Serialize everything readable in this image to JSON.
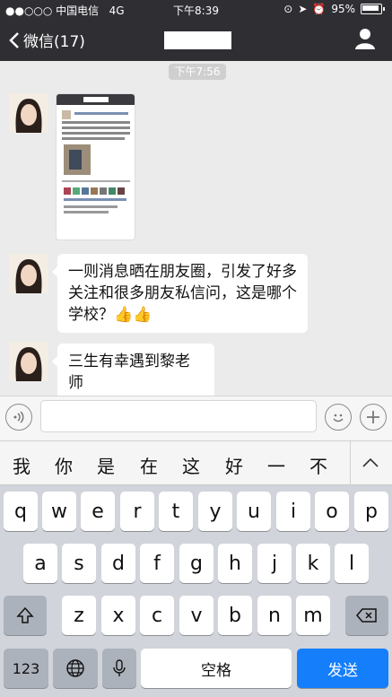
{
  "status": {
    "carrier": "●●○○○ 中国电信",
    "network": "4G",
    "time": "下午8:39",
    "battery": "95%"
  },
  "nav": {
    "back_label": "微信(17)"
  },
  "chat": {
    "timestamp": "下午7:56",
    "messages": [
      {
        "type": "image"
      },
      {
        "type": "text",
        "lines": [
          "一则消息晒在朋友圈，引发了好多",
          "关注和很多朋友私信问，这是哪个",
          "学校？👍👍"
        ]
      },
      {
        "type": "text",
        "lines": [
          "三生有幸遇到黎老师"
        ]
      }
    ]
  },
  "candidates": [
    "我",
    "你",
    "是",
    "在",
    "这",
    "好",
    "一",
    "不"
  ],
  "keyboard": {
    "row1": [
      "q",
      "w",
      "e",
      "r",
      "t",
      "y",
      "u",
      "i",
      "o",
      "p"
    ],
    "row2": [
      "a",
      "s",
      "d",
      "f",
      "g",
      "h",
      "j",
      "k",
      "l"
    ],
    "row3": [
      "z",
      "x",
      "c",
      "v",
      "b",
      "n",
      "m"
    ],
    "num_label": "123",
    "space_label": "空格",
    "send_label": "发送"
  },
  "colors": {
    "nav_bg": "#2e2e33",
    "send_blue": "#147efb",
    "chat_bg": "#ebebeb"
  }
}
